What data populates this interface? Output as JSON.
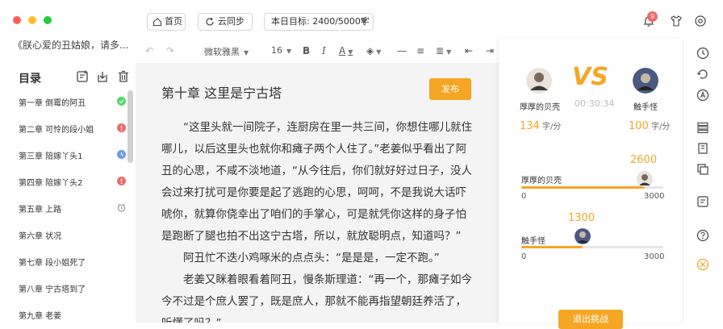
{
  "book": {
    "title": "《朕心爱的丑姑娘，请多..."
  },
  "toc": {
    "title": "目录",
    "items": [
      {
        "label": "第一章 倒霉的阿丑",
        "status": "done"
      },
      {
        "label": "第二章 可怜的段小姐",
        "status": "error"
      },
      {
        "label": "第三章 陪嫁丫头1",
        "status": "pending"
      },
      {
        "label": "第四章 陪嫁丫头2",
        "status": "error"
      },
      {
        "label": "第五章 上路",
        "status": "scheduled"
      },
      {
        "label": "第六章 状况",
        "status": "none"
      },
      {
        "label": "第七章 段小姐死了",
        "status": "none"
      },
      {
        "label": "第八章 宁古塔到了",
        "status": "none"
      },
      {
        "label": "第九章 老姜",
        "status": "none"
      }
    ]
  },
  "topbar": {
    "home_label": "首页",
    "sync_label": "云同步",
    "goal_label": "本日目标: 2400/5000字",
    "notification_count": "9"
  },
  "format": {
    "font": "微软雅黑",
    "size": "16",
    "bold": "B",
    "italic": "I",
    "font_color": "A"
  },
  "editor": {
    "chapter_title": "第十章  这里是宁古塔",
    "publish_label": "发布",
    "paragraphs": [
      "“这里头就一间院子，连厨房在里一共三间，你想住哪儿就住哪儿，以后这里头也就你和瘫子两个人住了。”老姜似乎看出了阿丑的心思，不咸不淡地道，“从今往后，你们就好好过日子，没人会过来打扰可是你要是起了逃跑的心思，呵呵，不是我说大话吓唬你，就算你侥幸出了咱们的手掌心，可是就凭你这样的身子怕是跑断了腿也拍不出这宁古塔，所以，就放聪明点，知道吗？”",
      "阿丑忙不迭小鸡啄米的点点头：“是是是，一定不跑。”",
      "老姜又眯着眼看着阿丑，慢条斯理道：“再一个，那瘫子如今今不过是个庶人罢了，既是庶人，那就不能再指望朝廷养活了，听懂了吗？”"
    ]
  },
  "battle": {
    "vs": "VS",
    "timer": "00:30:34",
    "unit": "字/分",
    "player1": {
      "name": "厚厚的贝壳",
      "speed": "134",
      "words": "2600",
      "progress": 0.8667
    },
    "player2": {
      "name": "触手怪",
      "speed": "100",
      "words": "1300",
      "progress": 0.4333
    },
    "axis_min": "0",
    "axis_max": "3000",
    "exit_label": "退出挑战"
  },
  "colors": {
    "accent": "#f5a623",
    "done": "#4cd964",
    "error": "#ee6b6b",
    "pending": "#6b9ce8",
    "notification": "#f06a6a"
  }
}
